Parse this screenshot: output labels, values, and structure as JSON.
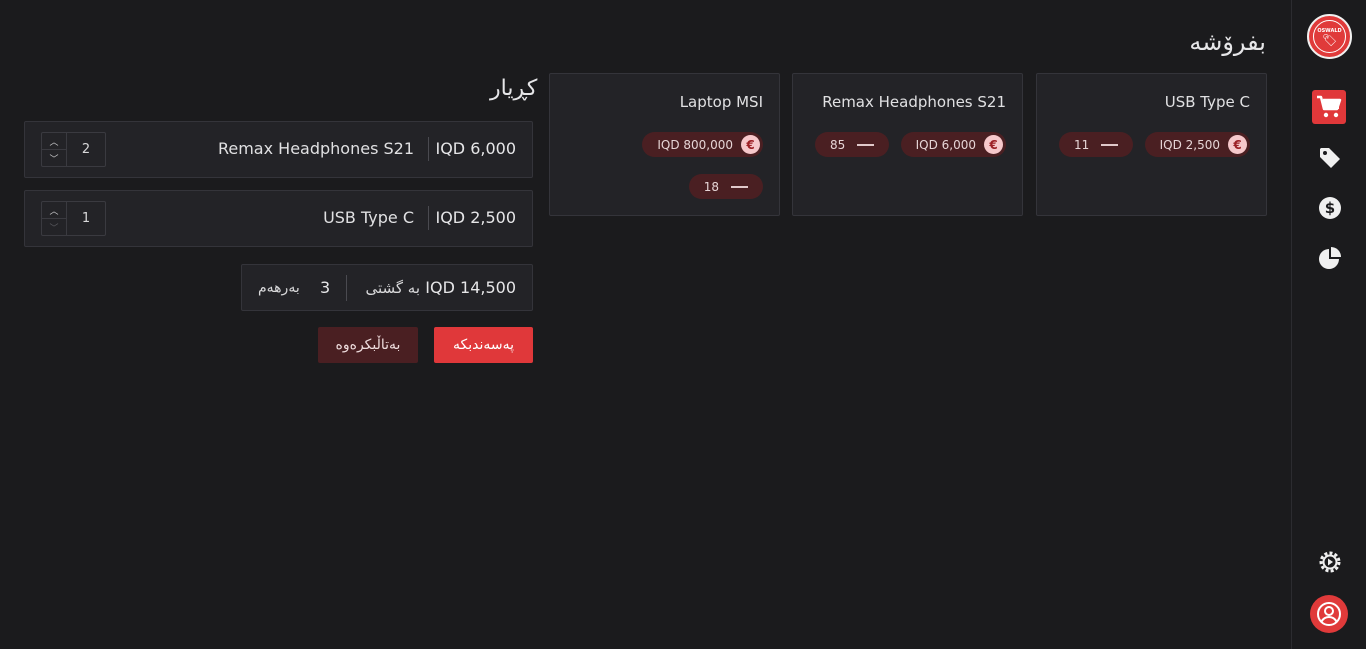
{
  "app": {
    "logo_text": "OSWALD",
    "page_title": "بفرۆشە"
  },
  "products": [
    {
      "name": "USB Type C",
      "price": "IQD 2,500",
      "stock": "11"
    },
    {
      "name": "Remax Headphones S21",
      "price": "IQD 6,000",
      "stock": "85"
    },
    {
      "name": "Laptop MSI",
      "price": "IQD 800,000",
      "stock": "18"
    }
  ],
  "cart": {
    "title": "کڕیار",
    "items": [
      {
        "name": "Remax Headphones S21",
        "price": "IQD 6,000",
        "qty": "2"
      },
      {
        "name": "USB Type C",
        "price": "IQD 2,500",
        "qty": "1"
      }
    ],
    "summary": {
      "total_label": "بە گشتی",
      "total_value": "IQD 14,500",
      "count_label": "بەرهەم",
      "count_value": "3"
    },
    "confirm_label": "پەسەندبکە",
    "cancel_label": "بەتاڵبکرەوە"
  },
  "sidebar": {
    "items": [
      {
        "icon": "cart-icon",
        "active": true
      },
      {
        "icon": "tag-icon",
        "active": false
      },
      {
        "icon": "dollar-icon",
        "active": false
      },
      {
        "icon": "pie-chart-icon",
        "active": false
      }
    ],
    "bottom": [
      {
        "icon": "settings-icon"
      },
      {
        "icon": "user-icon"
      }
    ]
  },
  "colors": {
    "accent": "#e0383a",
    "background": "#1b1b1d",
    "card": "#232327",
    "pill": "#4a1f22"
  }
}
